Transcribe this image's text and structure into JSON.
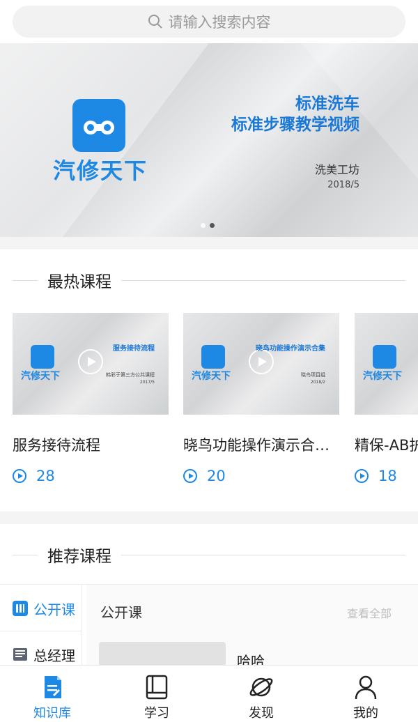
{
  "search": {
    "placeholder": "请输入搜索内容"
  },
  "banner": {
    "logo_text": "汽修天下",
    "title_line1": "标准洗车",
    "title_line2": "标准步骤教学视频",
    "author": "洗美工坊",
    "date": "2018/5",
    "slide_count": 2,
    "active_slide": 1
  },
  "hot": {
    "title": "最热课程",
    "courses": [
      {
        "title": "服务接待流程",
        "plays": "28",
        "thumb_title": "服务接待流程",
        "thumb_sub": "韩彩于第三方公共课程",
        "thumb_date": "2017/5",
        "logo": "汽修天下"
      },
      {
        "title": "晓鸟功能操作演示合…",
        "plays": "20",
        "thumb_title": "晓鸟功能操作演示合集",
        "thumb_sub": "晓鸟项目组",
        "thumb_date": "2018/2",
        "logo": "汽修天下"
      },
      {
        "title": "精保-AB护",
        "plays": "18",
        "thumb_title": "",
        "thumb_sub": "",
        "thumb_date": "",
        "logo": "汽修天下"
      }
    ]
  },
  "recommend": {
    "title": "推荐课程",
    "sidebar": [
      {
        "label": "公开课",
        "active": true
      },
      {
        "label": "总经理",
        "active": false
      }
    ],
    "main_title": "公开课",
    "view_all": "查看全部",
    "first_item": "哈哈"
  },
  "tabs": [
    {
      "label": "知识库",
      "active": true,
      "icon": "document-icon"
    },
    {
      "label": "学习",
      "active": false,
      "icon": "book-icon"
    },
    {
      "label": "发现",
      "active": false,
      "icon": "planet-icon"
    },
    {
      "label": "我的",
      "active": false,
      "icon": "user-icon"
    }
  ],
  "colors": {
    "accent": "#1e88e5"
  }
}
